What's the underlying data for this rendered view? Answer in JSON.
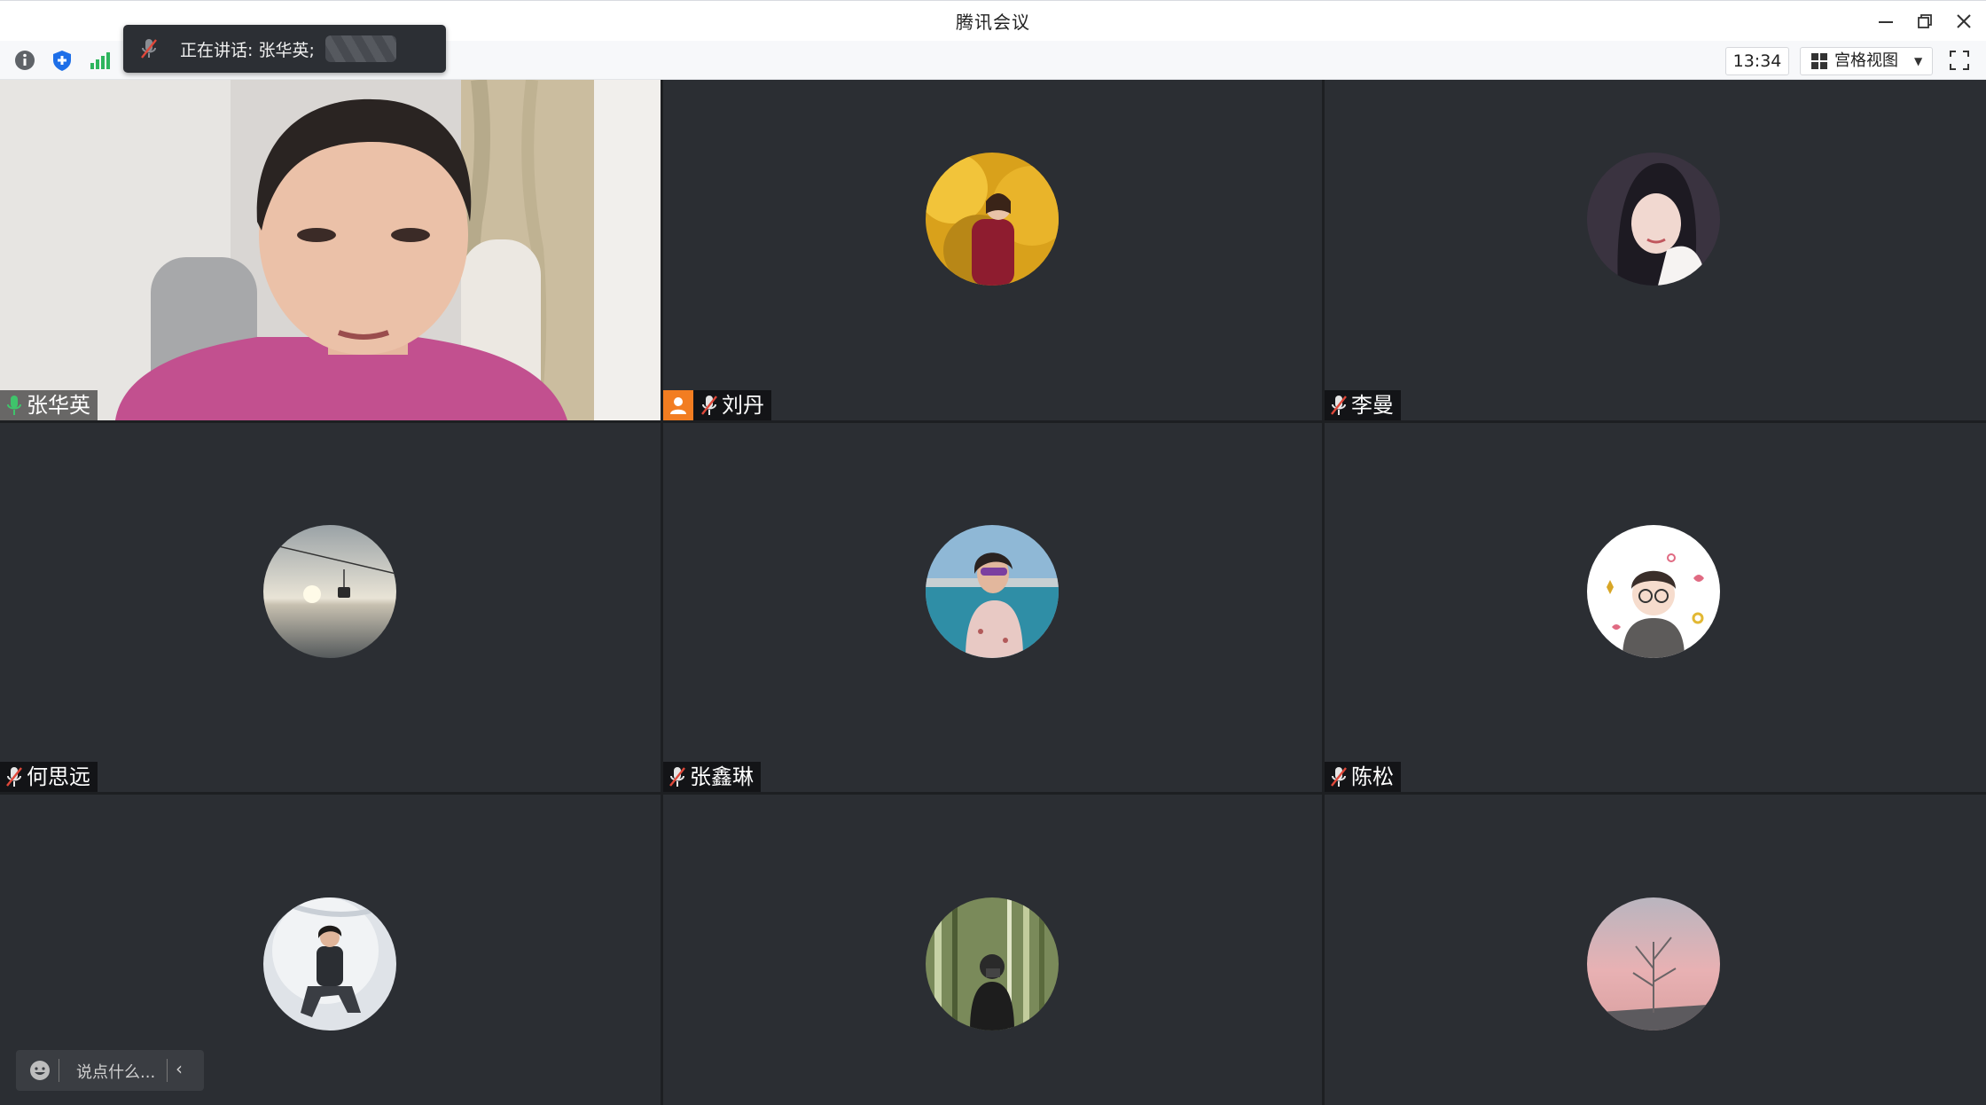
{
  "window": {
    "title": "腾讯会议"
  },
  "toolbar": {
    "clock": "13:34",
    "view_label": "宫格视图",
    "view_caret": "▼"
  },
  "speaking": {
    "text": "正在讲话: 张华英;"
  },
  "participants": [
    {
      "name": "张华英",
      "mic": "on",
      "video": true
    },
    {
      "name": "刘丹",
      "mic": "muted",
      "host": true
    },
    {
      "name": "李曼",
      "mic": "muted"
    },
    {
      "name": "何思远",
      "mic": "muted"
    },
    {
      "name": "张鑫琳",
      "mic": "muted"
    },
    {
      "name": "陈松",
      "mic": "muted"
    },
    {
      "name": "",
      "mic": "muted"
    },
    {
      "name": "",
      "mic": "muted"
    },
    {
      "name": "",
      "mic": "muted"
    }
  ],
  "chat": {
    "placeholder": "说点什么...",
    "chevron": "‹"
  },
  "colors": {
    "tile_bg": "#2b2e33",
    "active_border": "#3fb56a",
    "host_badge": "#f27d21",
    "muted_mic": "#e0483a"
  }
}
